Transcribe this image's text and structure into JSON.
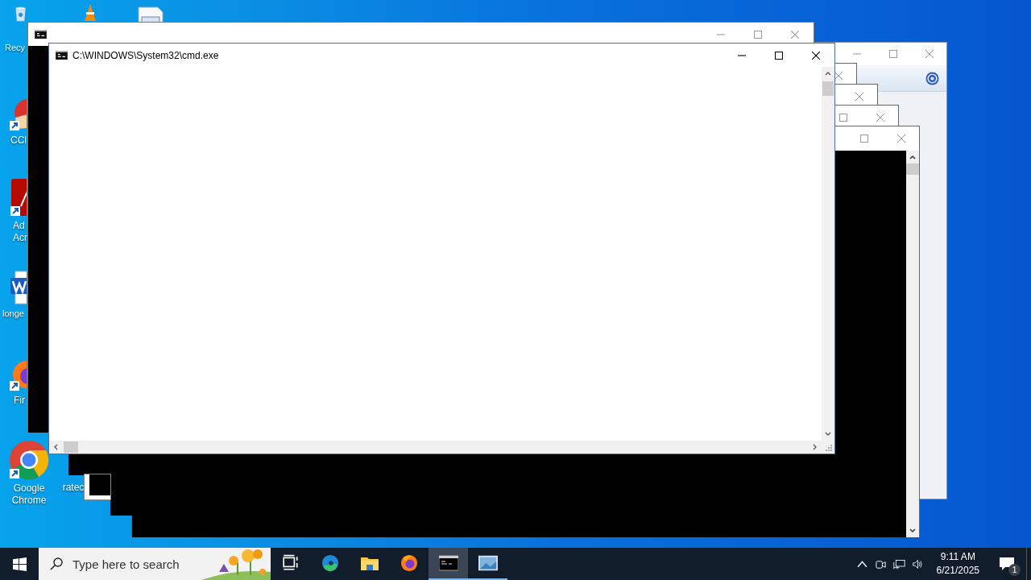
{
  "desktop_icons": [
    {
      "kind": "recycle-bin",
      "label": [
        "Recy"
      ]
    },
    {
      "kind": "cone"
    },
    {
      "kind": "document"
    },
    {
      "kind": "ccleaner",
      "label": [
        "CCl"
      ]
    },
    {
      "kind": "acrobat",
      "label": [
        "Ad",
        "Acr"
      ]
    },
    {
      "kind": "word",
      "label": [
        "longe"
      ]
    },
    {
      "kind": "firefox",
      "label": [
        "Fir"
      ]
    },
    {
      "kind": "chrome",
      "label": [
        "Google",
        "Chrome"
      ]
    },
    {
      "kind": "covered",
      "label": [
        "ratec"
      ]
    }
  ],
  "windows": [
    {
      "active": false
    },
    {
      "title": "C:\\WINDOWS\\System32\\cmd.exe",
      "active": true
    }
  ],
  "taskbar": {
    "search": {
      "placeholder": "Type here to search"
    },
    "apps": [
      {
        "kind": "task-view",
        "running": false,
        "selected": false
      },
      {
        "kind": "edge",
        "running": false,
        "selected": false
      },
      {
        "kind": "explorer",
        "running": false,
        "selected": false
      },
      {
        "kind": "firefox",
        "running": false,
        "selected": false
      },
      {
        "kind": "cmd",
        "running": true,
        "selected": true
      },
      {
        "kind": "picture-viewer",
        "running": true,
        "selected": false
      }
    ],
    "clock": {
      "time": "9:11 AM",
      "date": "6/21/2025"
    },
    "notifications": {
      "badge": "1"
    }
  }
}
